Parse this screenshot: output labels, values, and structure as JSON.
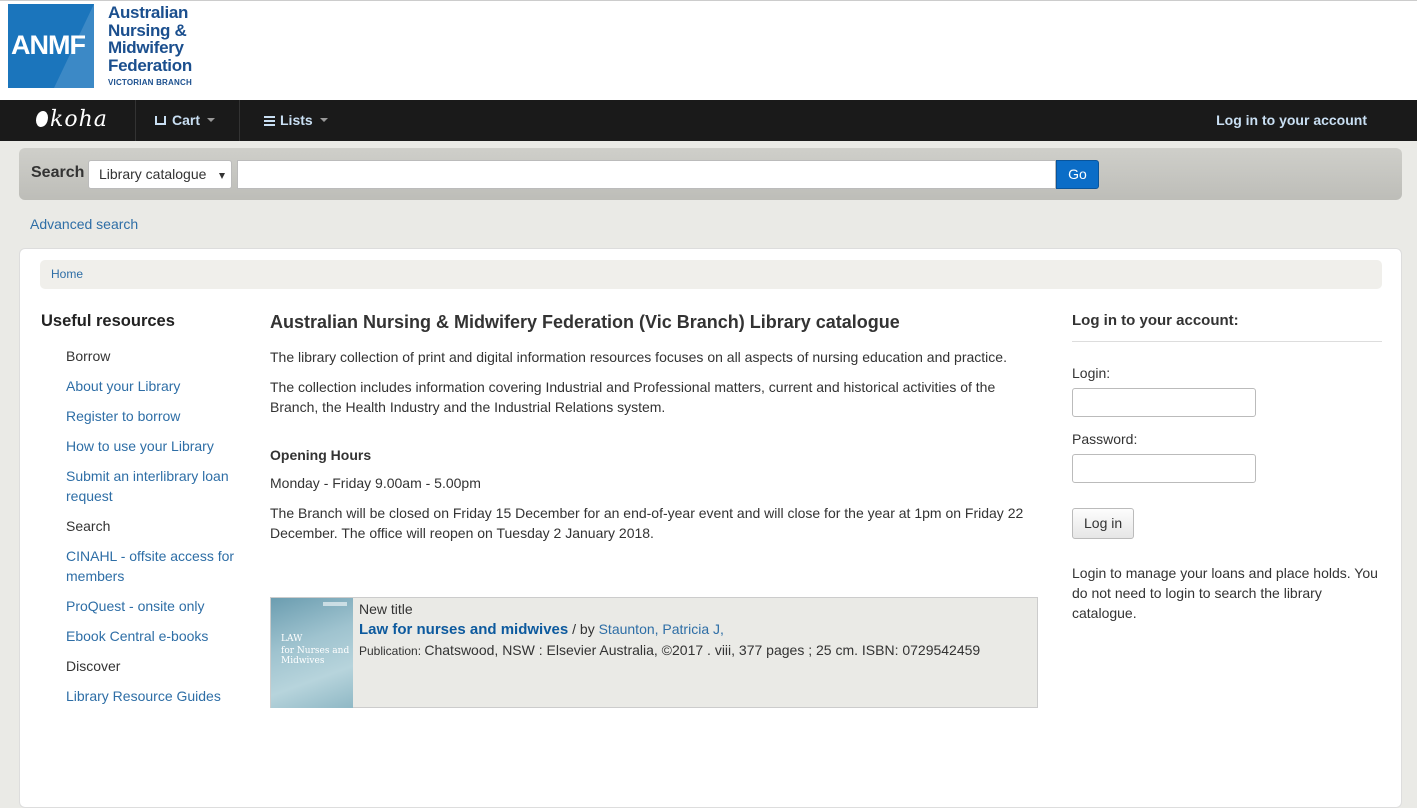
{
  "brand": {
    "logo_abbr": "ANMF",
    "logo_lines": [
      "Australian",
      "Nursing &",
      "Midwifery",
      "Federation"
    ],
    "logo_sub": "VICTORIAN BRANCH",
    "koha": "koha",
    "primary_color": "#1b75bc"
  },
  "nav": {
    "cart": "Cart",
    "lists": "Lists",
    "login": "Log in to your account"
  },
  "search": {
    "label": "Search",
    "select_value": "Library catalogue",
    "input_value": "",
    "go": "Go"
  },
  "advanced_search": "Advanced search",
  "breadcrumb": {
    "home": "Home"
  },
  "sidebar": {
    "title": "Useful resources",
    "items": [
      {
        "label": "Borrow",
        "type": "header"
      },
      {
        "label": "About your Library",
        "type": "link"
      },
      {
        "label": "Register to borrow",
        "type": "link"
      },
      {
        "label": "How to use your Library",
        "type": "link"
      },
      {
        "label": "Submit an interlibrary loan request",
        "type": "link"
      },
      {
        "label": "Search",
        "type": "header"
      },
      {
        "label": "CINAHL - offsite access for members",
        "type": "link"
      },
      {
        "label": "ProQuest - onsite only",
        "type": "link"
      },
      {
        "label": "Ebook Central e-books",
        "type": "link"
      },
      {
        "label": "Discover",
        "type": "header"
      },
      {
        "label": "Library Resource Guides",
        "type": "link"
      }
    ]
  },
  "content": {
    "title": "Australian Nursing & Midwifery Federation (Vic Branch) Library catalogue",
    "p1": "The library collection of print and digital information resources focuses on all aspects of nursing education and practice.",
    "p2": "The collection includes information covering Industrial and Professional matters, current and historical activities of the Branch, the Health Industry and the Industrial Relations system.",
    "hours_title": "Opening Hours",
    "hours": "Monday - Friday 9.00am - 5.00pm",
    "closure": "The Branch will be closed on Friday 15 December for an end-of-year event and will close for the year at 1pm on Friday 22 December. The office will reopen on Tuesday 2 January 2018."
  },
  "new_title": {
    "label": "New title",
    "title": "Law for nurses and midwives",
    "slash": " / ",
    "by": "by ",
    "author": "Staunton, Patricia J,",
    "pub_label": "Publication: ",
    "pub": "Chatswood, NSW : Elsevier Australia, ©2017 . viii, 377 pages ; 25 cm. ISBN: 0729542459",
    "cover_law": "LAW",
    "cover_title": "for Nurses and Midwives"
  },
  "login": {
    "title": "Log in to your account:",
    "login_label": "Login:",
    "password_label": "Password:",
    "button": "Log in",
    "info": "Login to manage your loans and place holds. You do not need to login to search the library catalogue."
  }
}
